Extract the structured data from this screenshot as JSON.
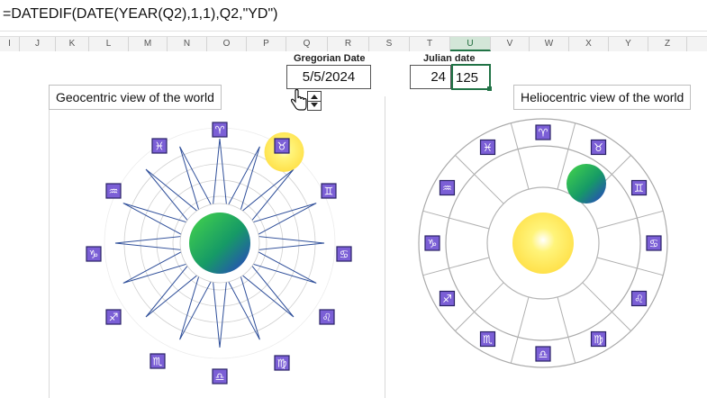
{
  "formula_bar": {
    "formula": "=DATEDIF(DATE(YEAR(Q2),1,1),Q2,\"YD\")"
  },
  "columns": [
    "I",
    "J",
    "K",
    "L",
    "M",
    "N",
    "O",
    "P",
    "Q",
    "R",
    "S",
    "T",
    "U",
    "V",
    "W",
    "X",
    "Y",
    "Z"
  ],
  "active_column": "U",
  "gregorian": {
    "label": "Gregorian Date",
    "value": "5/5/2024"
  },
  "julian": {
    "label": "Julian date",
    "day": "24",
    "value": "125"
  },
  "geocentric": {
    "title": "Geocentric view of the world"
  },
  "heliocentric": {
    "title": "Heliocentric view of the world"
  },
  "zodiac": [
    {
      "name": "aries",
      "glyph": "♈"
    },
    {
      "name": "taurus",
      "glyph": "♉"
    },
    {
      "name": "gemini",
      "glyph": "♊"
    },
    {
      "name": "cancer",
      "glyph": "♋"
    },
    {
      "name": "leo",
      "glyph": "♌"
    },
    {
      "name": "virgo",
      "glyph": "♍"
    },
    {
      "name": "libra",
      "glyph": "♎"
    },
    {
      "name": "scorpio",
      "glyph": "♏"
    },
    {
      "name": "sagittarius",
      "glyph": "♐"
    },
    {
      "name": "capricorn",
      "glyph": "♑"
    },
    {
      "name": "aquarius",
      "glyph": "♒"
    },
    {
      "name": "pisces",
      "glyph": "♓"
    }
  ],
  "colors": {
    "zodiac_tile": "#7b5fd6",
    "star_line": "#2f4f9a",
    "sun_core": "#ffe95a",
    "earth_green": "#2fbf4a",
    "earth_blue": "#2c4fbf",
    "excel_green": "#217346"
  }
}
